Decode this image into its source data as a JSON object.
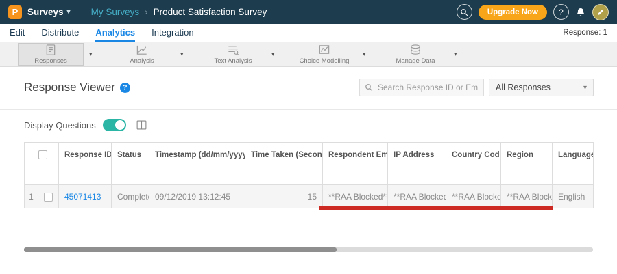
{
  "colors": {
    "topbar_bg": "#1d3c4e",
    "accent_blue": "#1a87e5",
    "logo_orange": "#f7941e",
    "upgrade_orange": "#f9a51a",
    "breadcrumb_teal": "#45aec6",
    "toggle_teal": "#2ab5a5",
    "annotation_red": "#ce2a24"
  },
  "glyphs": {
    "caret_down": "▾",
    "sort_desc": "▾",
    "sort_both": "⇅",
    "chevron": "›",
    "help": "?"
  },
  "topbar": {
    "logo_text": "P",
    "app_menu_label": "Surveys",
    "breadcrumb": {
      "parent": "My Surveys",
      "current": "Product Satisfaction Survey"
    },
    "upgrade_label": "Upgrade Now"
  },
  "tabs": {
    "items": [
      {
        "label": "Edit"
      },
      {
        "label": "Distribute"
      },
      {
        "label": "Analytics"
      },
      {
        "label": "Integration"
      }
    ],
    "response_count": "Response: 1"
  },
  "ribbon": {
    "items": [
      {
        "label": "Responses"
      },
      {
        "label": "Analysis"
      },
      {
        "label": "Text Analysis"
      },
      {
        "label": "Choice Modelling"
      },
      {
        "label": "Manage Data"
      }
    ]
  },
  "viewer": {
    "title": "Response Viewer",
    "search_placeholder": "Search Response ID or Email",
    "filter_dropdown_value": "All Responses",
    "display_questions_label": "Display Questions"
  },
  "table": {
    "columns": [
      {
        "label": "Response ID",
        "sort": "desc"
      },
      {
        "label": "Status",
        "sort": null
      },
      {
        "label": "Timestamp (dd/mm/yyyy)",
        "sort": "both"
      },
      {
        "label": "Time Taken (Seconds)",
        "sort": "both"
      },
      {
        "label": "Respondent Email",
        "sort": null
      },
      {
        "label": "IP Address",
        "sort": null
      },
      {
        "label": "Country Code",
        "sort": null
      },
      {
        "label": "Region",
        "sort": null
      },
      {
        "label": "Language",
        "sort": null
      }
    ],
    "rows": [
      {
        "index": "1",
        "response_id": "45071413",
        "status": "Completed",
        "timestamp": "09/12/2019 13:12:45",
        "time_taken": "15",
        "respondent_email": "**RAA Blocked**",
        "ip_address": "**RAA Blocked**",
        "country_code": "**RAA Blocked**",
        "region": "**RAA Blocked**",
        "language": "English"
      }
    ]
  }
}
